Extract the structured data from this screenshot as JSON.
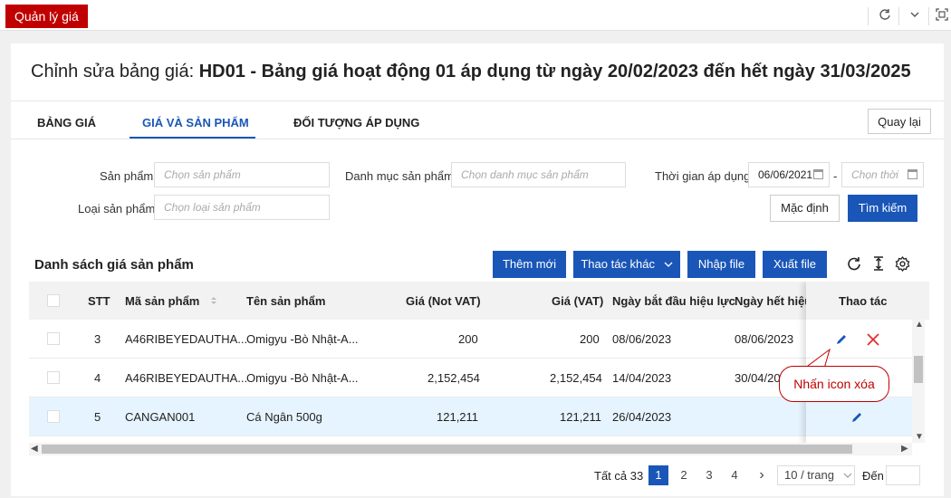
{
  "app": {
    "tab": "Quản lý giá"
  },
  "page": {
    "title_prefix": "Chỉnh sửa bảng giá: ",
    "title_main": "HD01 - Bảng giá hoạt động 01 áp dụng từ ngày 20/02/2023 đến hết ngày 31/03/2025"
  },
  "tabs": [
    {
      "label": "BẢNG GIÁ"
    },
    {
      "label": "GIÁ VÀ SẢN PHẨM"
    },
    {
      "label": "ĐỐI TƯỢNG ÁP DỤNG"
    }
  ],
  "back_label": "Quay lại",
  "filters": {
    "product_label": "Sản phẩm",
    "product_placeholder": "Chọn sản phẩm",
    "category_label": "Danh mục sản phẩm",
    "category_placeholder": "Chọn danh mục sản phẩm",
    "time_label": "Thời gian áp dụng",
    "date_from": "06/06/2021",
    "date_sep": "-",
    "date_to_placeholder": "Chọn thời",
    "type_label": "Loại sản phẩm",
    "type_placeholder": "Chọn loại sản phẩm",
    "default_label": "Mặc định",
    "search_label": "Tìm kiếm"
  },
  "list": {
    "title": "Danh sách giá sản phẩm",
    "add_label": "Thêm mới",
    "other_label": "Thao tác khác",
    "import_label": "Nhập file",
    "export_label": "Xuất file"
  },
  "table": {
    "headers": {
      "stt": "STT",
      "code": "Mã sản phẩm",
      "name": "Tên sản phẩm",
      "price_novat": "Giá (Not VAT)",
      "price_vat": "Giá (VAT)",
      "start": "Ngày bắt đầu hiệu lực",
      "end": "Ngày hết hiệu",
      "actions": "Thao tác"
    },
    "rows": [
      {
        "stt": "3",
        "code": "A46RIBEYEDAUTHA...",
        "name": "Omigyu -Bò Nhật-A...",
        "price_novat": "200",
        "price_vat": "200",
        "start": "08/06/2023",
        "end": "08/06/2023"
      },
      {
        "stt": "4",
        "code": "A46RIBEYEDAUTHA...",
        "name": "Omigyu -Bò Nhật-A...",
        "price_novat": "2,152,454",
        "price_vat": "2,152,454",
        "start": "14/04/2023",
        "end": "30/04/20"
      },
      {
        "stt": "5",
        "code": "CANGAN001",
        "name": "Cá Ngân 500g",
        "price_novat": "121,211",
        "price_vat": "121,211",
        "start": "26/04/2023",
        "end": ""
      }
    ]
  },
  "callout": "Nhấn icon xóa",
  "pagination": {
    "total": "Tất cả 33",
    "pages": [
      "1",
      "2",
      "3",
      "4"
    ],
    "next": "›",
    "page_size": "10 / trang",
    "goto_label": "Đến"
  },
  "colors": {
    "brand_red": "#c00000",
    "primary": "#1a56b8",
    "selected_row": "#e6f4ff",
    "delete": "#e03030"
  },
  "icons": [
    "refresh-icon",
    "chevron-down-icon",
    "fullscreen-icon",
    "calendar-icon",
    "reload-icon",
    "column-height-icon",
    "settings-icon",
    "edit-icon",
    "close-icon",
    "sort-icon"
  ]
}
